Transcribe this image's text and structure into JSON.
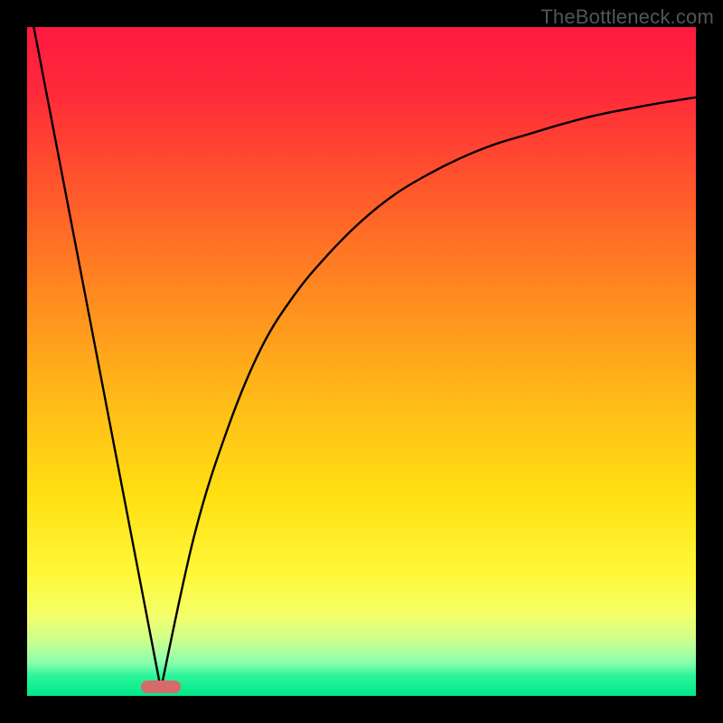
{
  "watermark": "TheBottleneck.com",
  "chart_data": {
    "type": "line",
    "title": "",
    "xlabel": "",
    "ylabel": "",
    "xlim": [
      0,
      100
    ],
    "ylim": [
      0,
      100
    ],
    "grid": false,
    "legend": false,
    "series": [
      {
        "name": "left-segment",
        "x": [
          1,
          20
        ],
        "y": [
          100,
          1
        ]
      },
      {
        "name": "right-curve",
        "x": [
          20,
          25,
          30,
          35,
          40,
          45,
          50,
          55,
          60,
          65,
          70,
          75,
          80,
          85,
          90,
          95,
          100
        ],
        "y": [
          1,
          24,
          40,
          52,
          60,
          66,
          71,
          75,
          78,
          80.5,
          82.5,
          84,
          85.5,
          86.8,
          87.8,
          88.7,
          89.5
        ]
      }
    ],
    "optimum_x": 20,
    "marker": {
      "x": 20,
      "color": "#d96a6a"
    },
    "background_gradient": {
      "top": "#ff1a40",
      "mid": "#ffe012",
      "bottom": "#00e88a"
    },
    "curve_color": "#000000",
    "curve_stroke": 2.4
  }
}
